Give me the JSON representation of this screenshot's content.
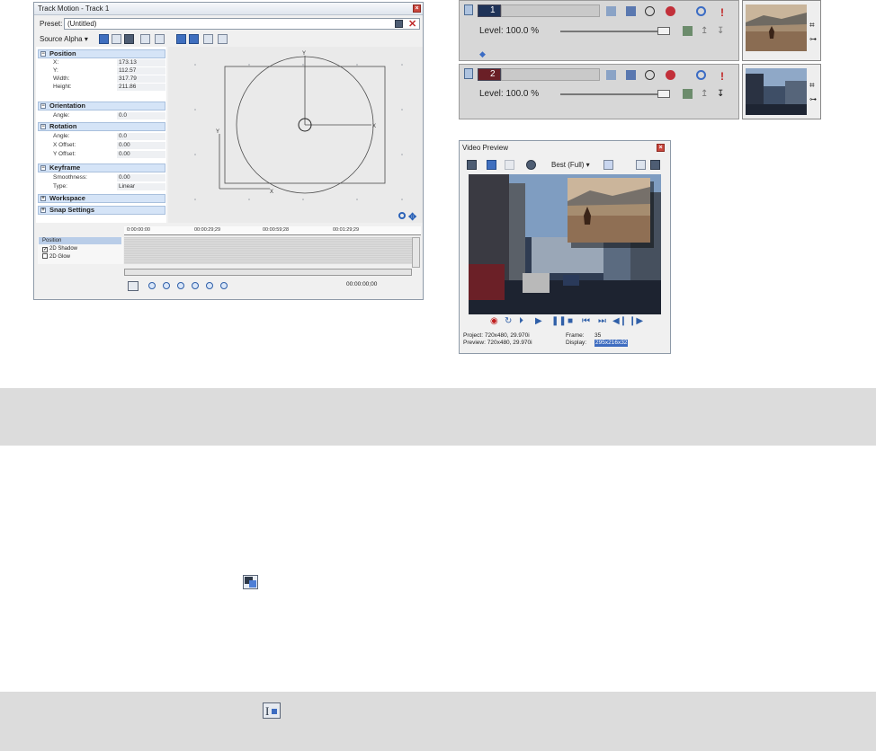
{
  "track_motion": {
    "title": "Track Motion - Track 1",
    "preset_label": "Preset:",
    "preset_value": "(Untitled)",
    "source_alpha_label": "Source Alpha",
    "sections": {
      "position": {
        "label": "Position",
        "rows": [
          {
            "k": "X:",
            "v": "173.13"
          },
          {
            "k": "Y:",
            "v": "112.57"
          },
          {
            "k": "Width:",
            "v": "317.79"
          },
          {
            "k": "Height:",
            "v": "211.86"
          }
        ]
      },
      "orientation": {
        "label": "Orientation",
        "rows": [
          {
            "k": "Angle:",
            "v": "0.0"
          }
        ]
      },
      "rotation": {
        "label": "Rotation",
        "rows": [
          {
            "k": "Angle:",
            "v": "0.0"
          },
          {
            "k": "X Offset:",
            "v": "0.00"
          },
          {
            "k": "Y Offset:",
            "v": "0.00"
          }
        ]
      },
      "keyframe": {
        "label": "Keyframe",
        "rows": [
          {
            "k": "Smoothness:",
            "v": "0.00"
          },
          {
            "k": "Type:",
            "v": "Linear"
          }
        ]
      },
      "workspace": {
        "label": "Workspace"
      },
      "snap_settings": {
        "label": "Snap Settings"
      }
    },
    "canvas": {
      "axis_x": "X",
      "axis_y": "Y"
    },
    "timeline": {
      "ticks": [
        "0:00:00:00",
        "00:00:29;29",
        "00:00:59;28",
        "00:01:29;29"
      ],
      "tracks": [
        {
          "label": "Position",
          "checked": false
        },
        {
          "label": "2D Shadow",
          "checked": true
        },
        {
          "label": "2D Glow",
          "checked": false
        }
      ],
      "time": "00:00:00;00"
    }
  },
  "tracks": [
    {
      "number": "1",
      "level": "Level: 100.0 %"
    },
    {
      "number": "2",
      "level": "Level: 100.0 %"
    }
  ],
  "video_preview": {
    "title": "Video Preview",
    "quality": "Best (Full)",
    "status": {
      "project": "Project:  720x480, 29.970i",
      "preview": "Preview:  720x480, 29.970i",
      "frame_label": "Frame:",
      "frame_value": "35",
      "display_label": "Display:",
      "display_value": "295x216x32"
    }
  },
  "colors": {
    "accent_blue": "#2f5fa8",
    "close_red": "#c9463d",
    "band_grey": "#dcdcdc"
  }
}
